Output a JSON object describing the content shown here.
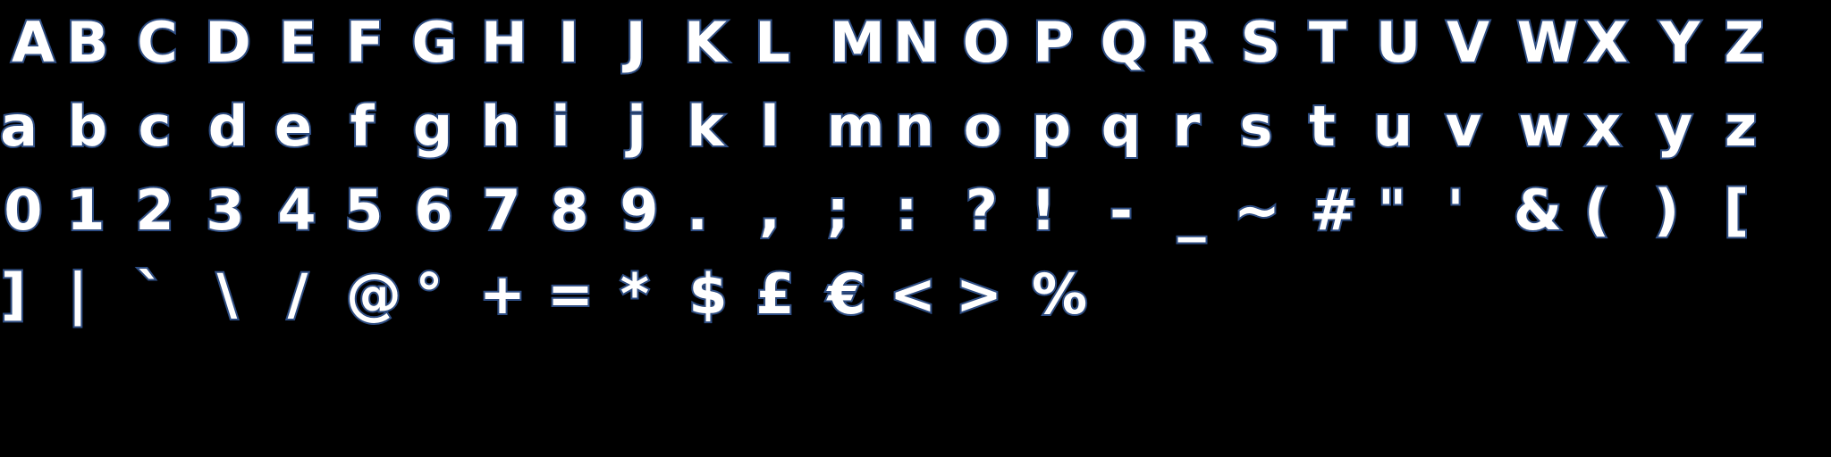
{
  "glyph_rows": [
    [
      "A",
      "B",
      "C",
      "D",
      "E",
      "F",
      "G",
      "H",
      "I",
      "J",
      "K",
      "L",
      "M",
      "N",
      "O",
      "P",
      "Q",
      "R",
      "S",
      "T",
      "U",
      "V",
      "W",
      "X",
      "Y",
      "Z"
    ],
    [
      "a",
      "b",
      "c",
      "d",
      "e",
      "f",
      "g",
      "h",
      "i",
      "j",
      "k",
      "l",
      "m",
      "n",
      "o",
      "p",
      "q",
      "r",
      "s",
      "t",
      "u",
      "v",
      "w",
      "x",
      "y",
      "z"
    ],
    [
      "0",
      "1",
      "2",
      "3",
      "4",
      "5",
      "6",
      "7",
      "8",
      "9",
      ".",
      ",",
      ";",
      ":",
      "?",
      "!",
      "-",
      "_",
      "~",
      "#",
      "\"",
      "'",
      "&",
      "(",
      ")",
      "["
    ],
    [
      "]",
      "|",
      "`",
      "\\",
      "/",
      "@",
      "°",
      "+",
      "=",
      "*",
      "$",
      "£",
      "€",
      "<",
      ">",
      "%"
    ]
  ],
  "colors": {
    "background": "#000000",
    "glyph_fill": "#ffffff",
    "glyph_outline": "#2f4f86"
  }
}
